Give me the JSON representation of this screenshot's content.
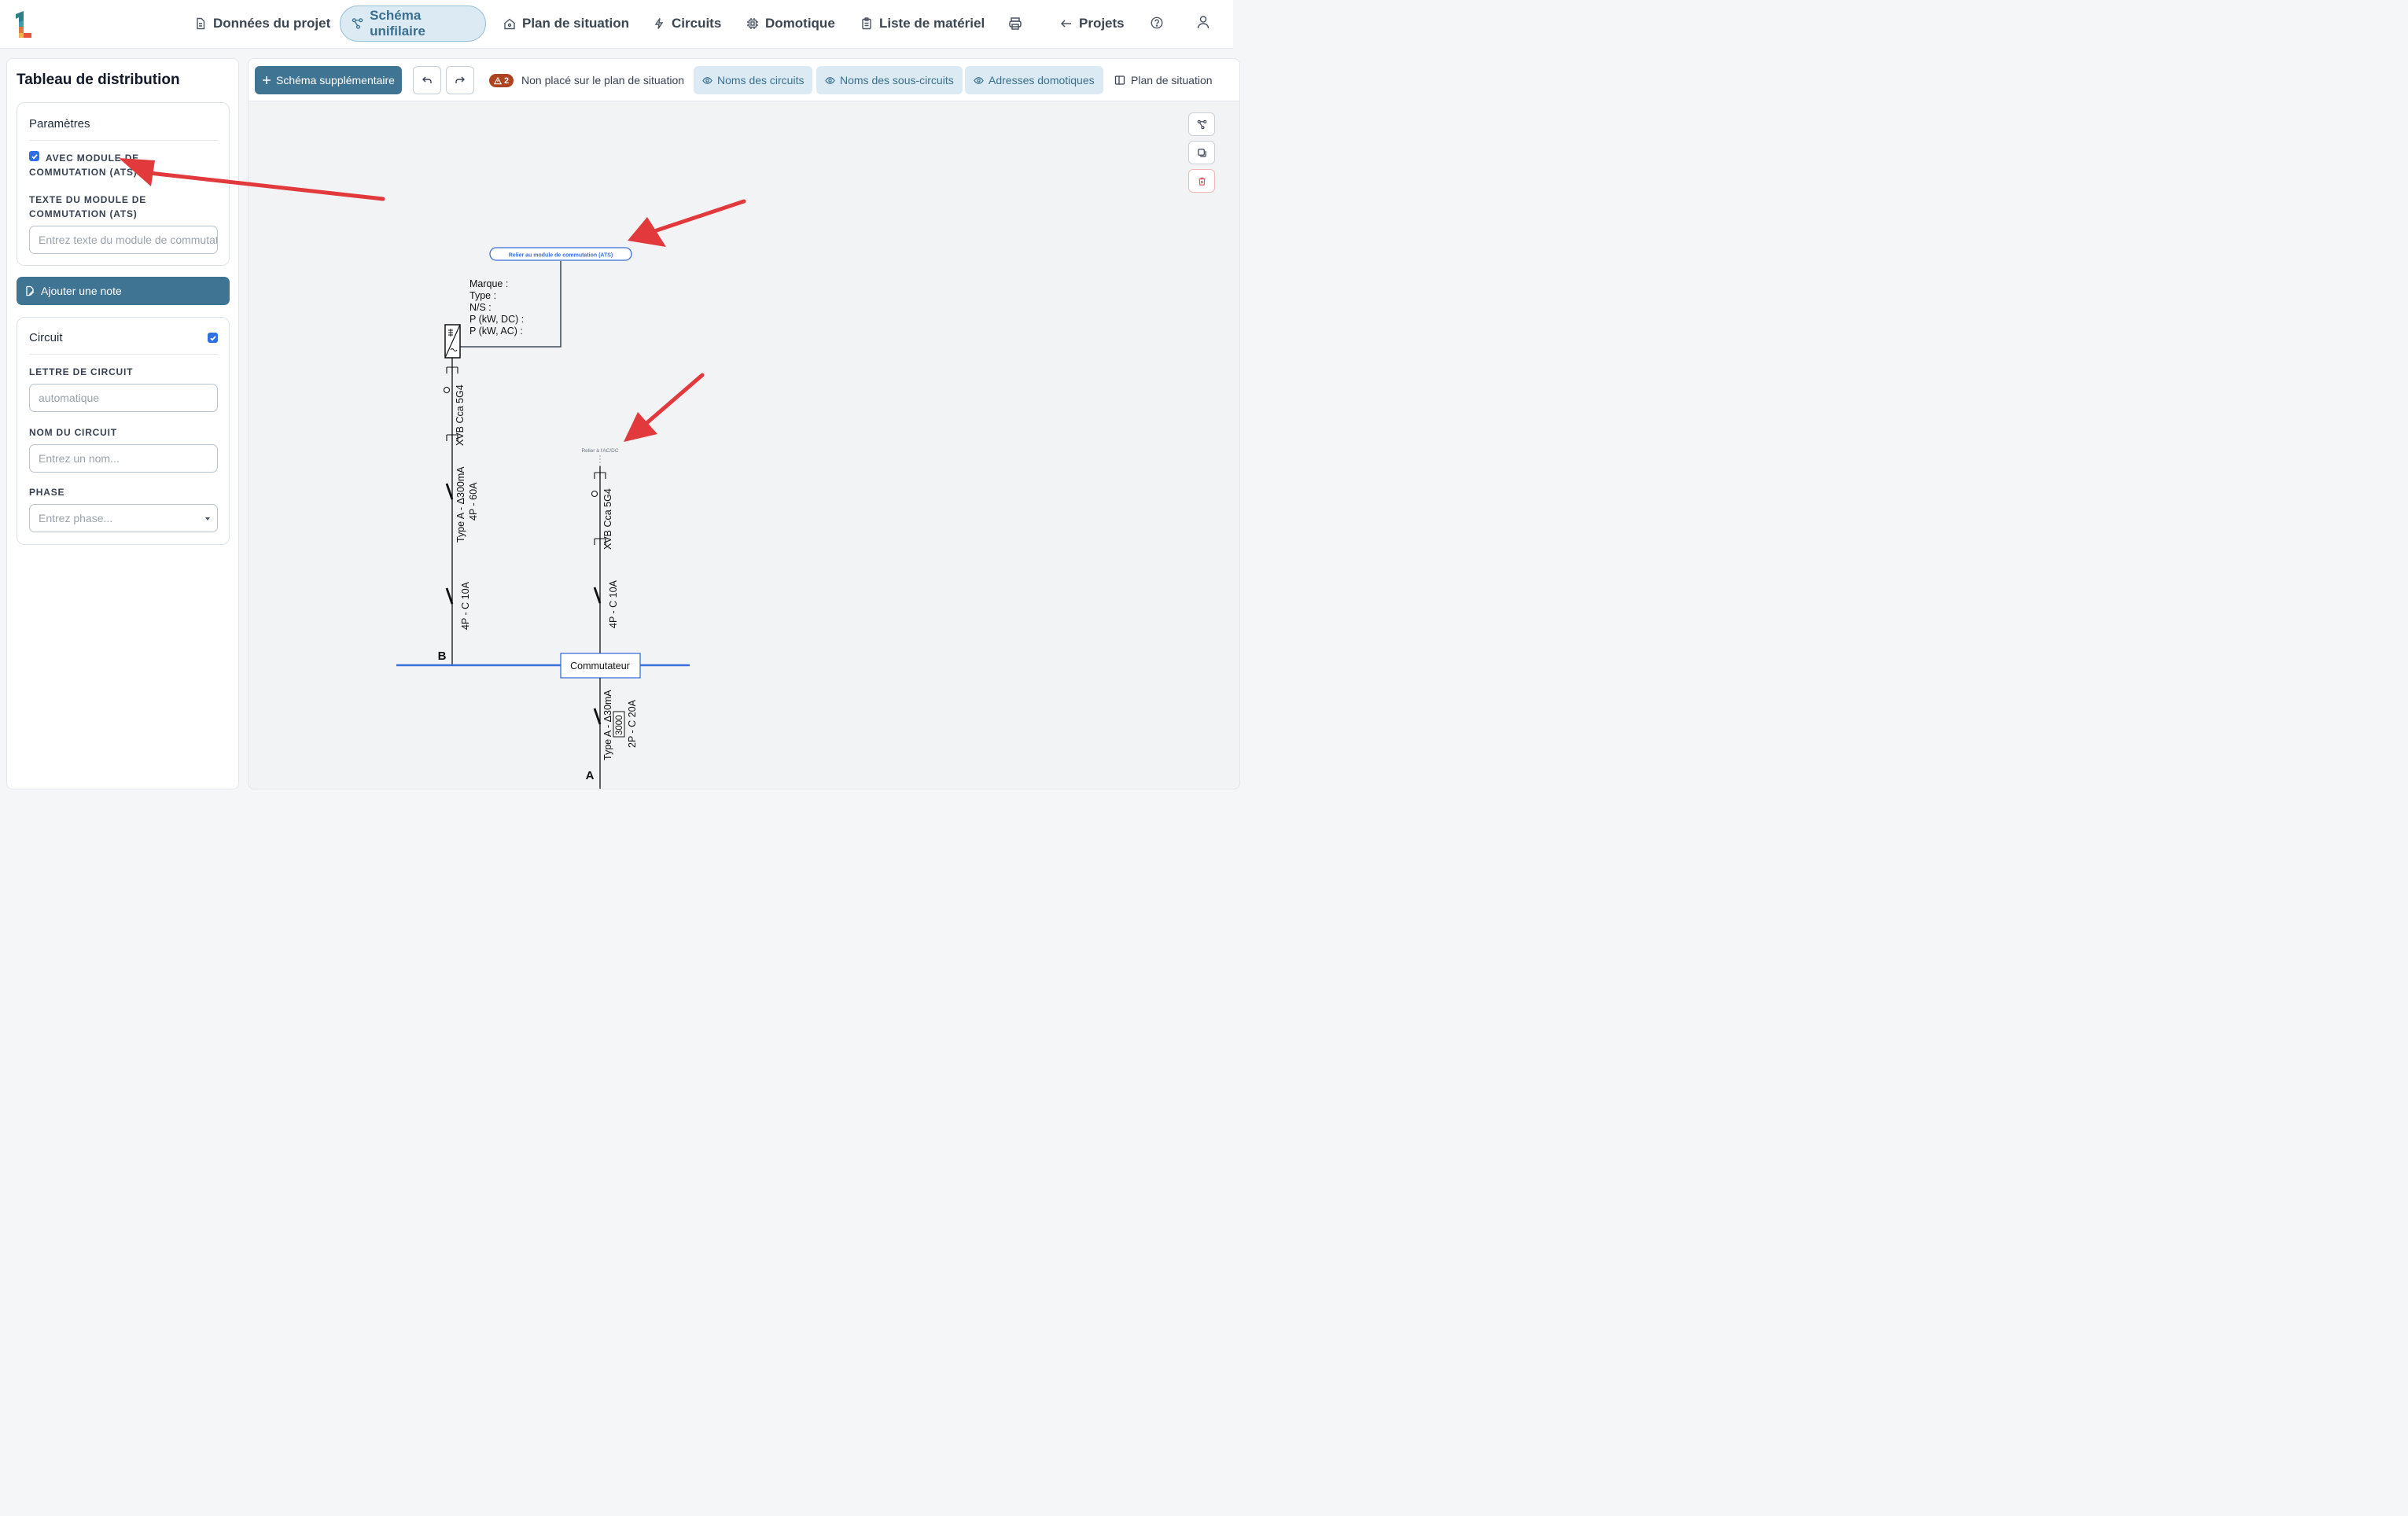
{
  "nav": {
    "items": [
      {
        "label": "Données du projet",
        "icon": "document-icon"
      },
      {
        "label": "Schéma unifilaire",
        "icon": "diagram-icon",
        "active": true
      },
      {
        "label": "Plan de situation",
        "icon": "house-icon"
      },
      {
        "label": "Circuits",
        "icon": "bolt-icon"
      },
      {
        "label": "Domotique",
        "icon": "chip-icon"
      },
      {
        "label": "Liste de matériel",
        "icon": "clipboard-icon"
      }
    ],
    "projects_label": "Projets"
  },
  "left_panel": {
    "title": "Tableau de distribution",
    "params": {
      "title": "Paramètres",
      "ats_checkbox_label": "AVEC MODULE DE COMMUTATION (ATS)",
      "ats_checked": true,
      "ats_text_label": "TEXTE DU MODULE DE COMMUTATION (ATS)",
      "ats_text_placeholder": "Entrez texte du module de commutation"
    },
    "add_note_label": "Ajouter une note",
    "circuit": {
      "title": "Circuit",
      "checked": true,
      "letter_label": "LETTRE DE CIRCUIT",
      "letter_placeholder": "automatique",
      "name_label": "NOM DU CIRCUIT",
      "name_placeholder": "Entrez un nom...",
      "phase_label": "PHASE",
      "phase_placeholder": "Entrez phase..."
    }
  },
  "toolbar": {
    "add_schema_label": "Schéma supplémentaire",
    "warning_count": "2",
    "warning_text": "Non placé sur le plan de situation",
    "toggles": [
      "Noms des circuits",
      "Noms des sous-circuits",
      "Adresses domotiques"
    ],
    "plan_label": "Plan de situation"
  },
  "schema": {
    "ats_link_label": "Relier au module de commutation (ATS)",
    "inverter_info": [
      "Marque :",
      "Type :",
      "N/S :",
      "P (kW, DC) :",
      "P (kW, AC) :"
    ],
    "acdc_link_label": "Relier à l'AC/DC",
    "left_cable": "XVB Cca 5G4",
    "left_rcd_line1": "Type A -  Δ300mA",
    "left_rcd_line2": "4P - 60A",
    "left_breaker": "4P - C 10A",
    "right_cable": "XVB Cca 5G4",
    "right_breaker": "4P - C 10A",
    "busbar_b_label": "B",
    "switch_label": "Commutateur",
    "bottom_rcd_line1": "Type A -  Δ30mA",
    "bottom_rcd_box": "3000",
    "bottom_rcd_line2": "2P - C 20A",
    "busbar_a_label": "A"
  },
  "colors": {
    "primary": "#3f7493",
    "active_nav_bg": "#dbeaf3",
    "busbar": "#3b6fd8",
    "warning": "#b0431f",
    "arrow": "#e2393c"
  }
}
